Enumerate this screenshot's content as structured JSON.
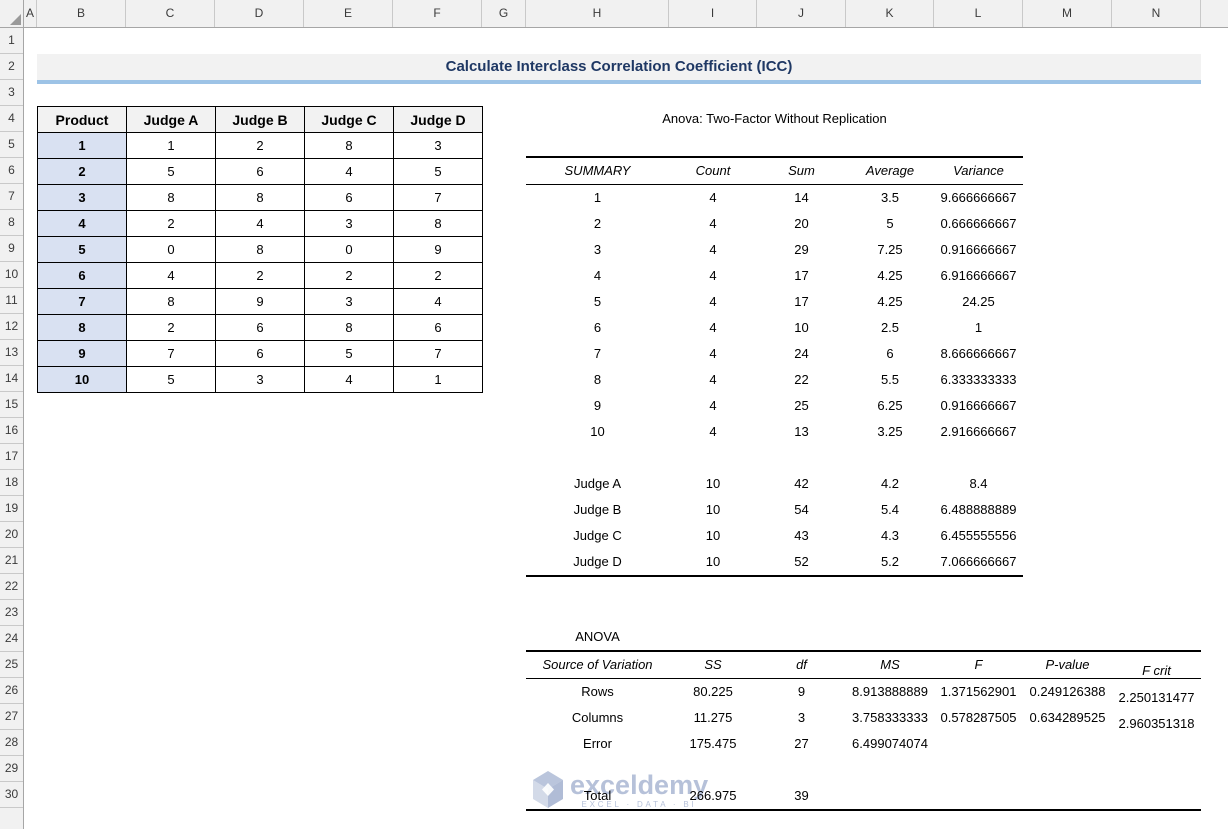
{
  "spreadsheet": {
    "column_headers": [
      "A",
      "B",
      "C",
      "D",
      "E",
      "F",
      "G",
      "H",
      "I",
      "J",
      "K",
      "L",
      "M",
      "N"
    ],
    "row_headers": [
      "1",
      "2",
      "3",
      "4",
      "5",
      "6",
      "7",
      "8",
      "9",
      "10",
      "11",
      "12",
      "13",
      "14",
      "15",
      "16",
      "17",
      "18",
      "19",
      "20",
      "21",
      "22",
      "23",
      "24",
      "25",
      "26",
      "27",
      "28",
      "29",
      "30"
    ]
  },
  "title_banner": {
    "text": "Calculate Interclass Correlation Coefficient (ICC)"
  },
  "product_table": {
    "headers": [
      "Product",
      "Judge A",
      "Judge B",
      "Judge C",
      "Judge D"
    ],
    "rows": [
      {
        "product": "1",
        "scores": [
          "1",
          "2",
          "8",
          "3"
        ]
      },
      {
        "product": "2",
        "scores": [
          "5",
          "6",
          "4",
          "5"
        ]
      },
      {
        "product": "3",
        "scores": [
          "8",
          "8",
          "6",
          "7"
        ]
      },
      {
        "product": "4",
        "scores": [
          "2",
          "4",
          "3",
          "8"
        ]
      },
      {
        "product": "5",
        "scores": [
          "0",
          "8",
          "0",
          "9"
        ]
      },
      {
        "product": "6",
        "scores": [
          "4",
          "2",
          "2",
          "2"
        ]
      },
      {
        "product": "7",
        "scores": [
          "8",
          "9",
          "3",
          "4"
        ]
      },
      {
        "product": "8",
        "scores": [
          "2",
          "6",
          "8",
          "6"
        ]
      },
      {
        "product": "9",
        "scores": [
          "7",
          "6",
          "5",
          "7"
        ]
      },
      {
        "product": "10",
        "scores": [
          "5",
          "3",
          "4",
          "1"
        ]
      }
    ]
  },
  "anova_output": {
    "title": "Anova: Two-Factor Without Replication",
    "summary_table": {
      "headers": [
        "SUMMARY",
        "Count",
        "Sum",
        "Average",
        "Variance"
      ],
      "rows": [
        [
          "1",
          "4",
          "14",
          "3.5",
          "9.666666667"
        ],
        [
          "2",
          "4",
          "20",
          "5",
          "0.666666667"
        ],
        [
          "3",
          "4",
          "29",
          "7.25",
          "0.916666667"
        ],
        [
          "4",
          "4",
          "17",
          "4.25",
          "6.916666667"
        ],
        [
          "5",
          "4",
          "17",
          "4.25",
          "24.25"
        ],
        [
          "6",
          "4",
          "10",
          "2.5",
          "1"
        ],
        [
          "7",
          "4",
          "24",
          "6",
          "8.666666667"
        ],
        [
          "8",
          "4",
          "22",
          "5.5",
          "6.333333333"
        ],
        [
          "9",
          "4",
          "25",
          "6.25",
          "0.916666667"
        ],
        [
          "10",
          "4",
          "13",
          "3.25",
          "2.916666667"
        ],
        [
          "",
          "",
          "",
          "",
          ""
        ],
        [
          "Judge A",
          "10",
          "42",
          "4.2",
          "8.4"
        ],
        [
          "Judge B",
          "10",
          "54",
          "5.4",
          "6.488888889"
        ],
        [
          "Judge C",
          "10",
          "43",
          "4.3",
          "6.455555556"
        ],
        [
          "Judge D",
          "10",
          "52",
          "5.2",
          "7.066666667"
        ]
      ]
    },
    "anova_table": {
      "label": "ANOVA",
      "headers": [
        "Source of Variation",
        "SS",
        "df",
        "MS",
        "F",
        "P-value",
        "F crit"
      ],
      "rows": [
        [
          "Rows",
          "80.225",
          "9",
          "8.913888889",
          "1.371562901",
          "0.249126388",
          "2.250131477"
        ],
        [
          "Columns",
          "11.275",
          "3",
          "3.758333333",
          "0.578287505",
          "0.634289525",
          "2.960351318"
        ],
        [
          "Error",
          "175.475",
          "27",
          "6.499074074",
          "",
          "",
          ""
        ],
        [
          "",
          "",
          "",
          "",
          "",
          "",
          ""
        ],
        [
          "Total",
          "266.975",
          "39",
          "",
          "",
          "",
          ""
        ]
      ]
    }
  },
  "watermark": {
    "brand": "exceldemy",
    "tagline": "EXCEL · DATA · BI"
  },
  "colors": {
    "title_text": "#1F3864",
    "banner_bg": "#F2F2F2",
    "banner_underline": "#9DC3E6",
    "product_header_bg": "#F2F2F2",
    "product_col_bg": "#D9E1F2",
    "chrome_bg": "#F1F1F1",
    "watermark": "#A4B2D0"
  }
}
